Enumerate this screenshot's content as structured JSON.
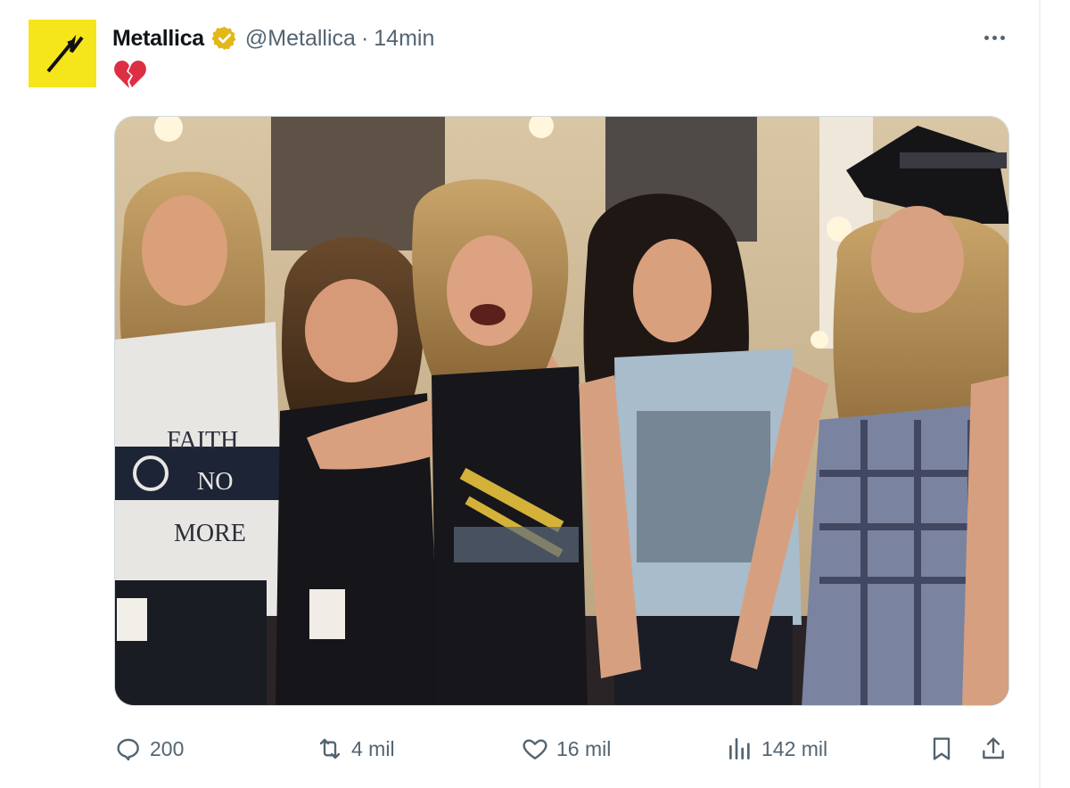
{
  "tweet": {
    "author_name": "Metallica",
    "handle": "@Metallica",
    "separator": "·",
    "time": "14min",
    "text_emoji": "broken-heart-emoji",
    "more_icon": "more-horizontal-icon",
    "verified_badge_color": "#e2b719",
    "avatar_bg_color": "#f5e51b"
  },
  "actions": {
    "replies": "200",
    "reposts": "4 mil",
    "likes": "16 mil",
    "views": "142 mil",
    "reply_icon": "reply-icon",
    "repost_icon": "repost-icon",
    "like_icon": "heart-icon",
    "views_icon": "views-icon",
    "bookmark_icon": "bookmark-icon",
    "share_icon": "share-icon"
  },
  "media": {
    "shirt_text_line1": "FAITH",
    "shirt_text_line2": "NO",
    "shirt_text_line3": "MORE"
  }
}
